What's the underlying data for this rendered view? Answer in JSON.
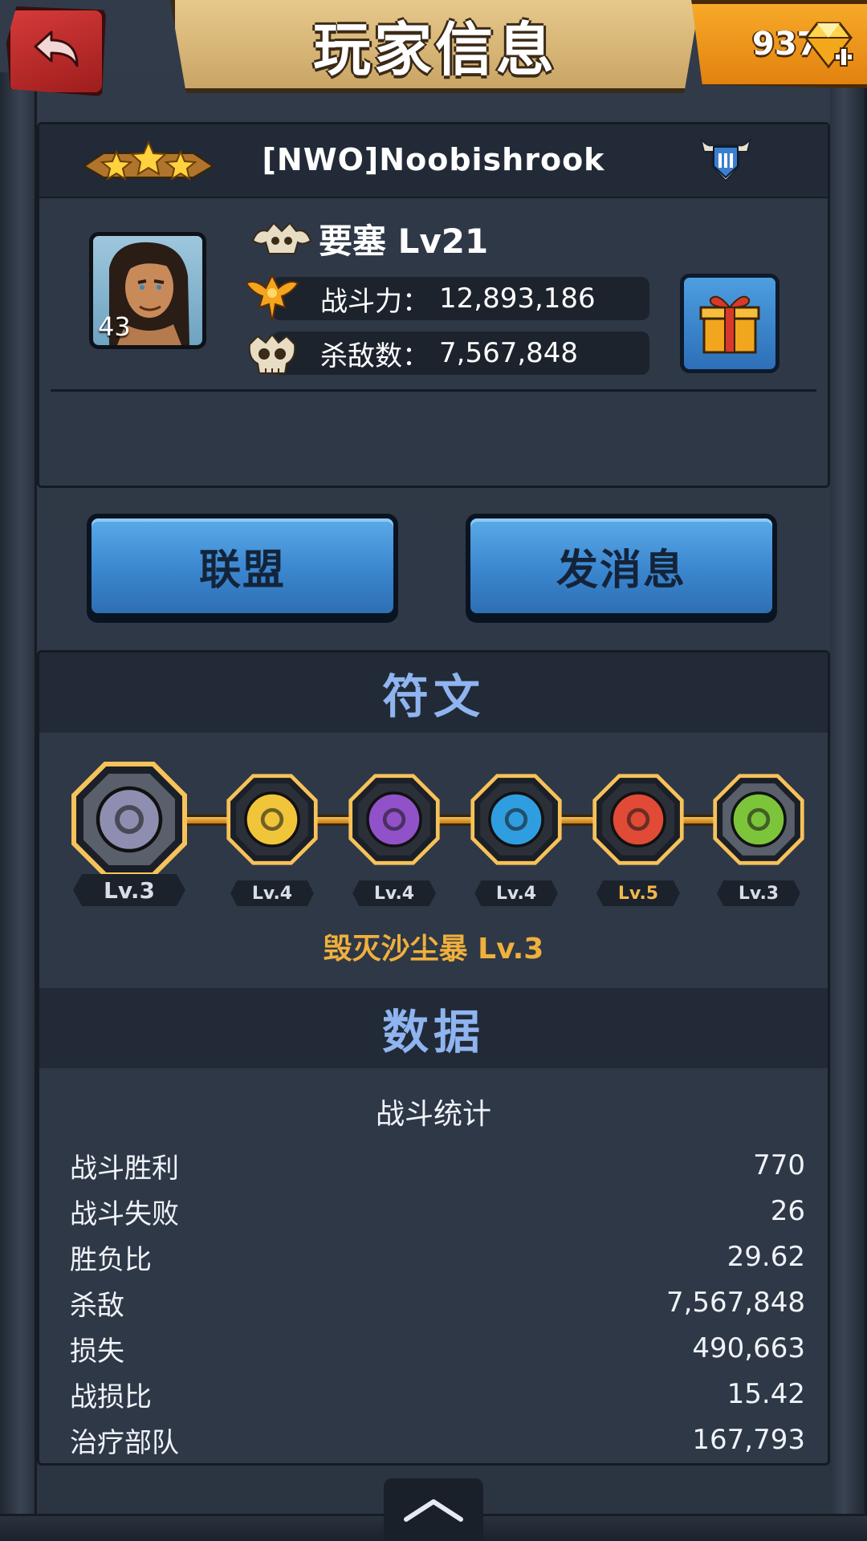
{
  "header": {
    "title": "玩家信息",
    "gems": "937",
    "back_icon": "back-arrow-icon",
    "gem_icon": "gem-plus-icon"
  },
  "profile": {
    "name": "[NWO]Noobishrook",
    "stars": 3,
    "avatar_level": "43",
    "fortress_label": "要塞 Lv21",
    "power_label": "战斗力：",
    "power_value": "12,893,186",
    "kills_label": "杀敌数：",
    "kills_value": "7,567,848"
  },
  "actions": {
    "alliance": "联盟",
    "message": "发消息"
  },
  "runes": {
    "title": "符文",
    "items": [
      {
        "level": "Lv.3",
        "color": "#8e8fb0",
        "icon": "sand-triangle-rune-icon",
        "highlight": false
      },
      {
        "level": "Lv.4",
        "color": "#f0c53a",
        "icon": "gear-rune-icon",
        "highlight": false
      },
      {
        "level": "Lv.4",
        "color": "#9152c9",
        "icon": "lightning-rune-icon",
        "highlight": false
      },
      {
        "level": "Lv.4",
        "color": "#2f9ee0",
        "icon": "star-rune-icon",
        "highlight": false
      },
      {
        "level": "Lv.5",
        "color": "#e04a36",
        "icon": "hammer-rune-icon",
        "highlight": true
      },
      {
        "level": "Lv.3",
        "color": "#7cc43a",
        "icon": "sun-rune-icon",
        "highlight": false
      }
    ],
    "selected_caption": "毁灭沙尘暴 Lv.3"
  },
  "stats": {
    "title": "数据",
    "subtitle": "战斗统计",
    "rows": [
      {
        "label": "战斗胜利",
        "value": "770"
      },
      {
        "label": "战斗失败",
        "value": "26"
      },
      {
        "label": "胜负比",
        "value": "29.62"
      },
      {
        "label": "杀敌",
        "value": "7,567,848"
      },
      {
        "label": "损失",
        "value": "490,663"
      },
      {
        "label": "战损比",
        "value": "15.42"
      },
      {
        "label": "治疗部队",
        "value": "167,793"
      }
    ]
  }
}
